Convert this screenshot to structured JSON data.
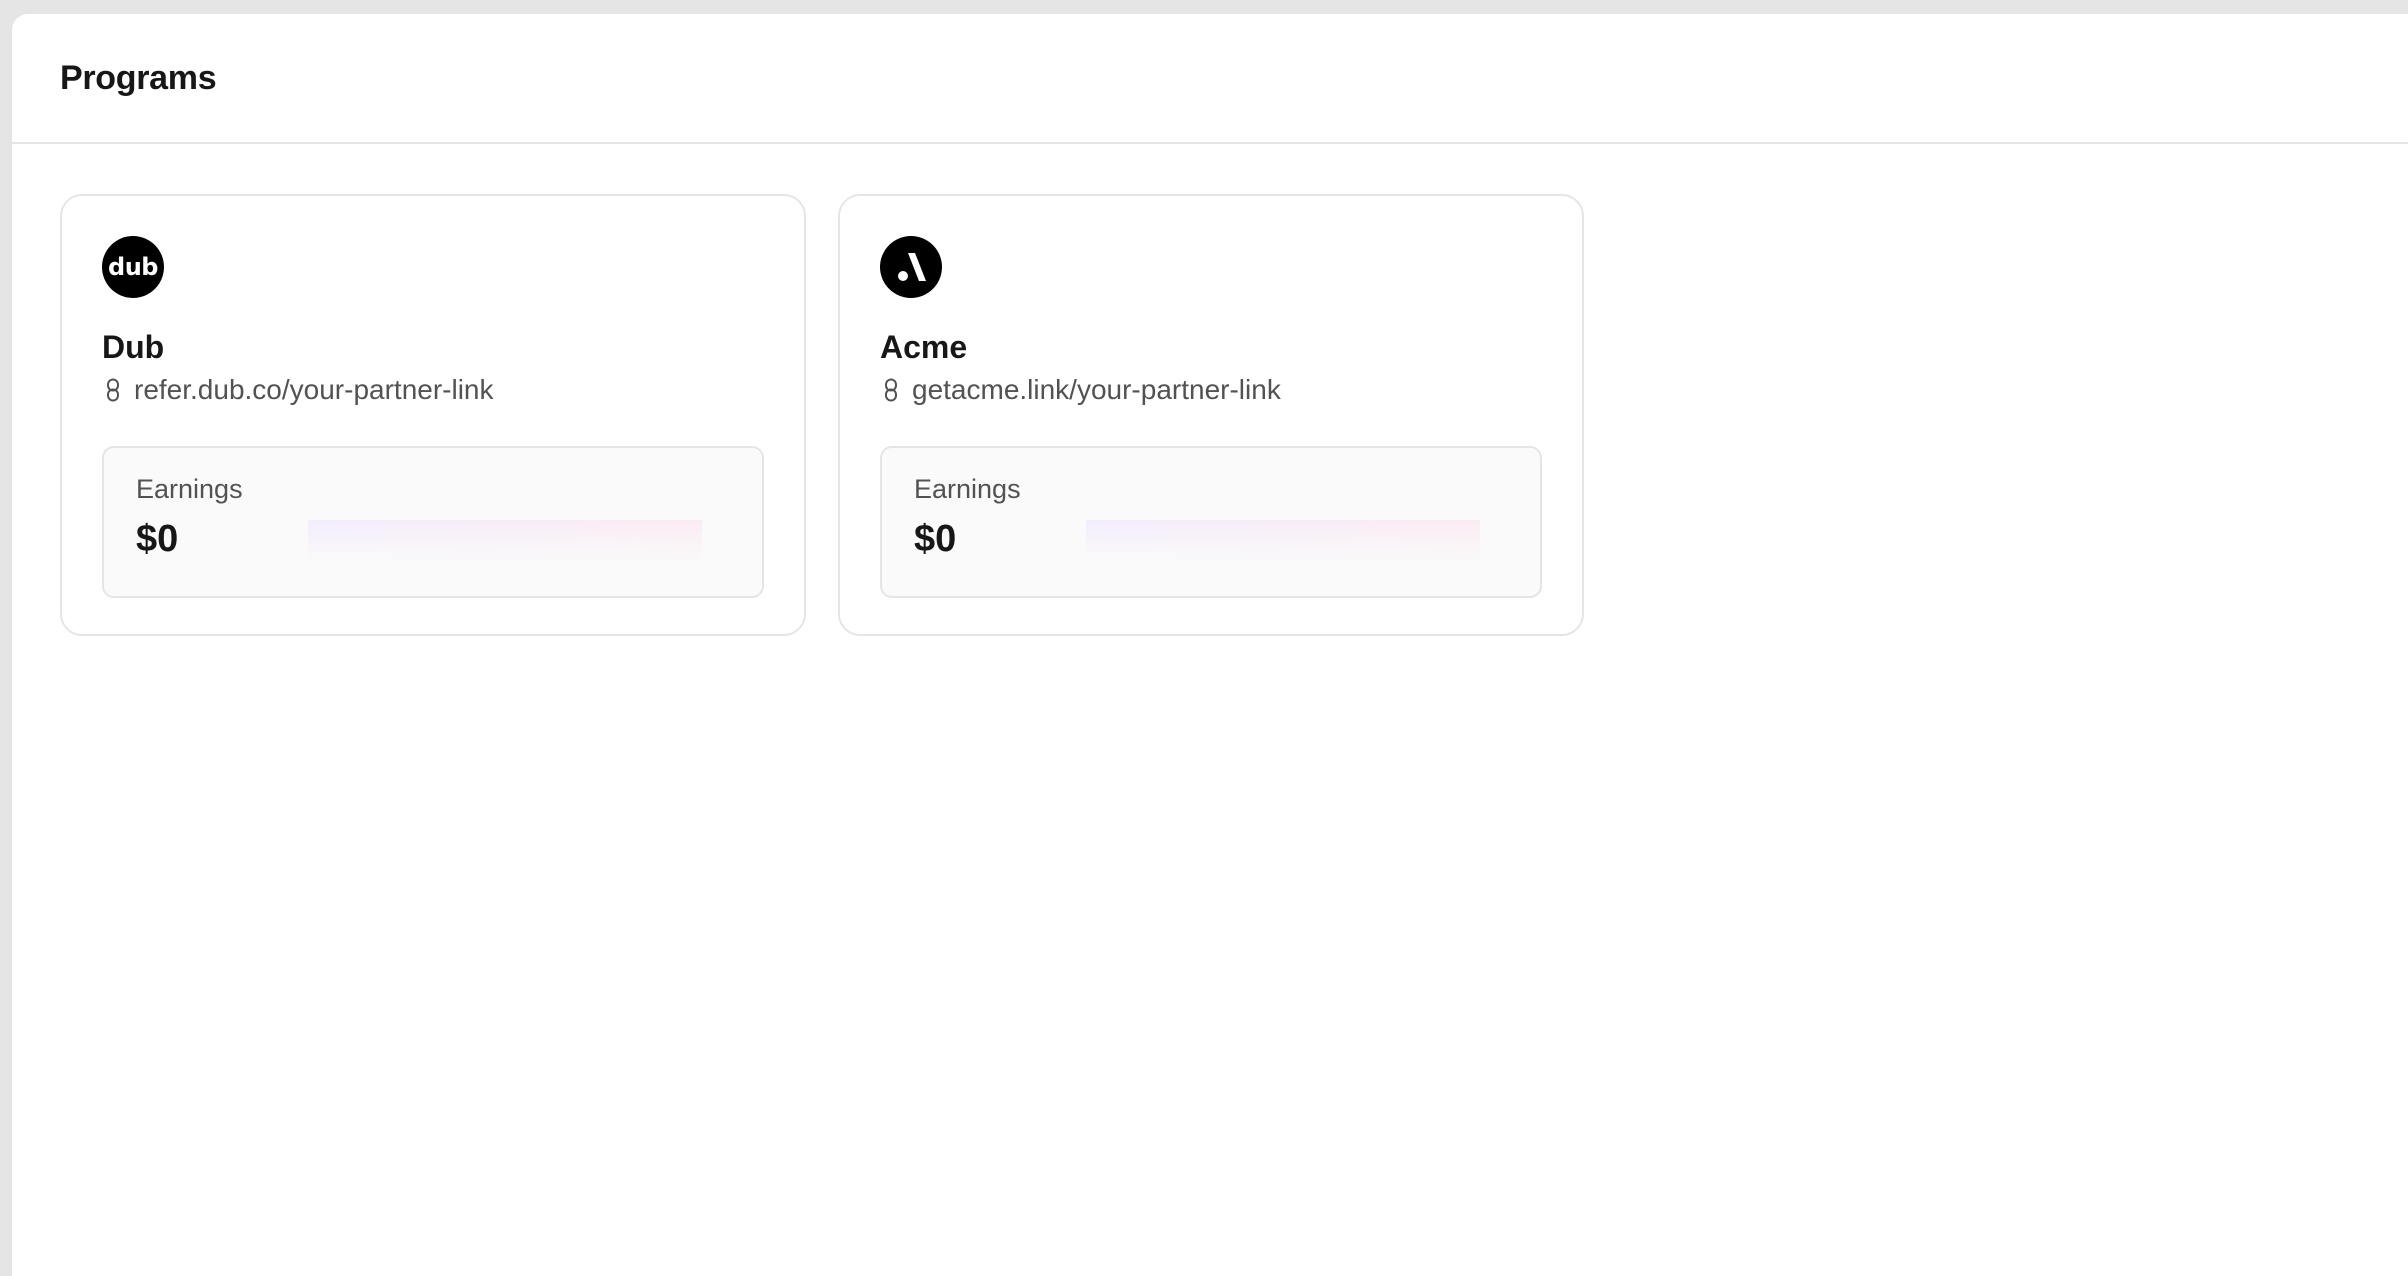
{
  "page": {
    "title": "Programs"
  },
  "programs": [
    {
      "name": "Dub",
      "logo_text": "dub",
      "logo_icon": "dub-logo",
      "link": "refer.dub.co/your-partner-link",
      "earnings_label": "Earnings",
      "earnings_value": "$0"
    },
    {
      "name": "Acme",
      "logo_text": "",
      "logo_icon": "acme-logo",
      "link": "getacme.link/your-partner-link",
      "earnings_label": "Earnings",
      "earnings_value": "$0"
    }
  ],
  "colors": {
    "sparkline_start": "#7c3aed",
    "sparkline_end": "#db2777",
    "border": "#e5e5e5",
    "panel_bg": "#fafafa"
  },
  "icons": {
    "link": "link-icon"
  }
}
